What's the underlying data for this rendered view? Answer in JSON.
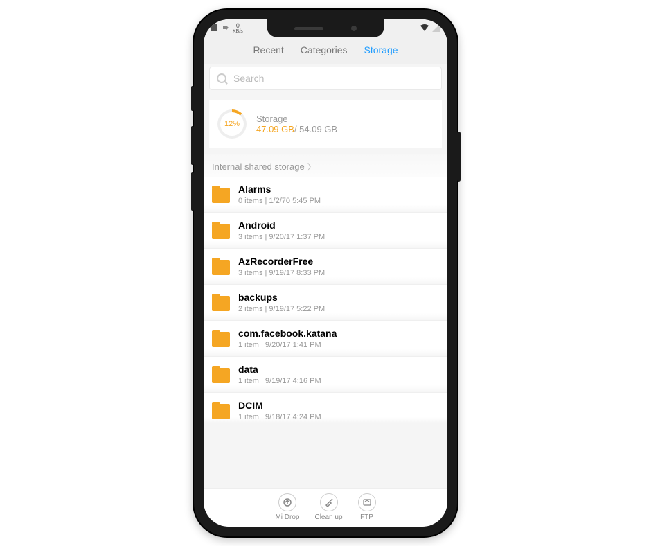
{
  "statusbar": {
    "kb_value": "0",
    "kb_unit": "KB/s"
  },
  "tabs": {
    "recent": "Recent",
    "categories": "Categories",
    "storage": "Storage"
  },
  "search": {
    "placeholder": "Search"
  },
  "storage_card": {
    "percent": "12%",
    "label": "Storage",
    "used": "47.09 GB",
    "sep": "/ ",
    "total": "54.09 GB"
  },
  "breadcrumb": {
    "path": "Internal shared storage"
  },
  "folders": [
    {
      "name": "Alarms",
      "meta": "0 items  |  1/2/70 5:45 PM"
    },
    {
      "name": "Android",
      "meta": "3 items  |  9/20/17 1:37 PM"
    },
    {
      "name": "AzRecorderFree",
      "meta": "3 items  |  9/19/17 8:33 PM"
    },
    {
      "name": "backups",
      "meta": "2 items  |  9/19/17 5:22 PM"
    },
    {
      "name": "com.facebook.katana",
      "meta": "1 item  |  9/20/17 1:41 PM"
    },
    {
      "name": "data",
      "meta": "1 item  |  9/19/17 4:16 PM"
    },
    {
      "name": "DCIM",
      "meta": "1 item  |  9/18/17 4:24 PM"
    }
  ],
  "bottombar": {
    "mi_drop": "Mi Drop",
    "clean_up": "Clean up",
    "ftp": "FTP"
  }
}
